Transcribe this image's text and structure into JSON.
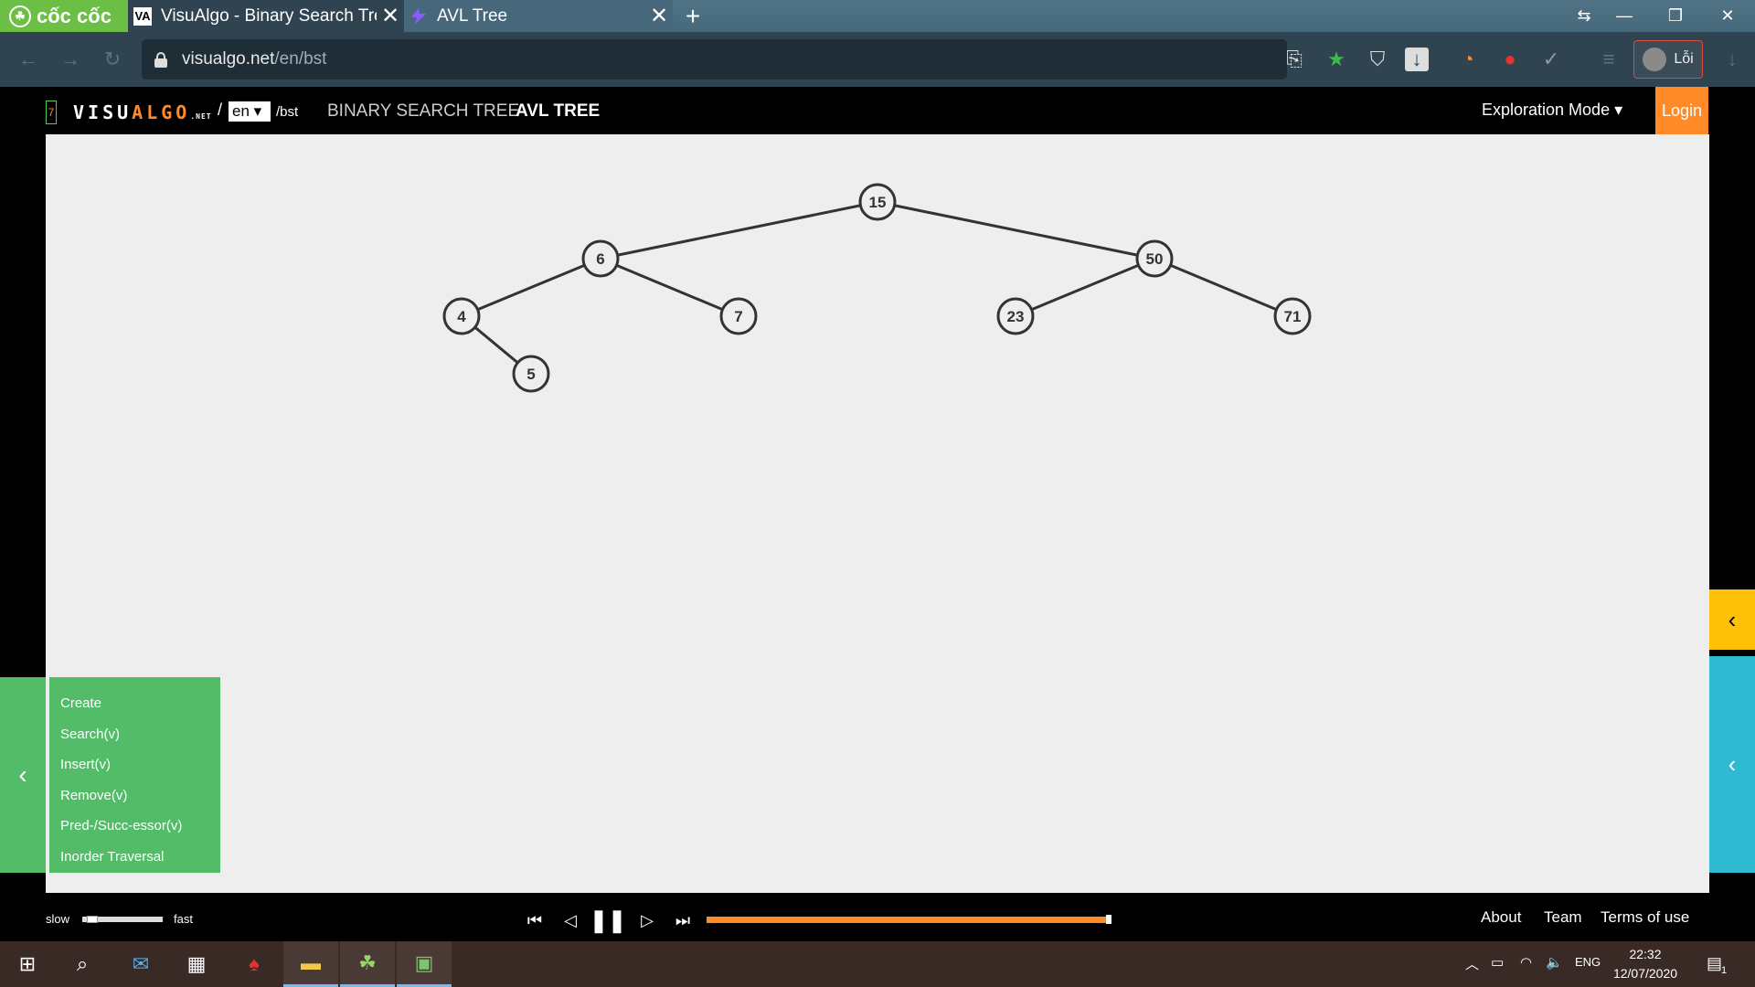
{
  "browser": {
    "brand": "cốc cốc",
    "tabs": [
      {
        "label": "VisuAlgo - Binary Search Tree",
        "favicon": "VA",
        "active": true
      },
      {
        "label": "AVL Tree",
        "favicon": "tree",
        "active": false
      }
    ],
    "new_tab": "+",
    "url_host": "visualgo.net",
    "url_path": "/en/bst",
    "profile_label": "Lỗi"
  },
  "header": {
    "logo_prefix": "VISU",
    "logo_suffix": "ALGO",
    "logo_small": ".NET",
    "logo_slash": "/",
    "lang": "en ▾",
    "path": "/bst",
    "nav": [
      "BINARY SEARCH TREE",
      "AVL TREE"
    ],
    "mode": "Exploration Mode ▾",
    "login": "Login",
    "seven": "7"
  },
  "tree": {
    "nodes": [
      {
        "id": "15",
        "label": "15"
      },
      {
        "id": "6",
        "label": "6"
      },
      {
        "id": "50",
        "label": "50"
      },
      {
        "id": "4",
        "label": "4"
      },
      {
        "id": "7",
        "label": "7"
      },
      {
        "id": "23",
        "label": "23"
      },
      {
        "id": "71",
        "label": "71"
      },
      {
        "id": "5",
        "label": "5"
      }
    ],
    "edges": [
      [
        "15",
        "6"
      ],
      [
        "15",
        "50"
      ],
      [
        "6",
        "4"
      ],
      [
        "6",
        "7"
      ],
      [
        "4",
        "5"
      ],
      [
        "50",
        "23"
      ],
      [
        "50",
        "71"
      ]
    ]
  },
  "menu": {
    "items": [
      "Create",
      "Search(v)",
      "Insert(v)",
      "Remove(v)",
      "Pred-/Succ-essor(v)",
      "Inorder Traversal"
    ]
  },
  "player": {
    "slow": "slow",
    "fast": "fast",
    "speed": 0.1,
    "progress": 1.0
  },
  "footer": {
    "links": [
      "About",
      "Team",
      "Terms of use"
    ]
  },
  "taskbar": {
    "time": "22:32",
    "date": "12/07/2020",
    "lang": "ENG",
    "notifications": "1"
  }
}
